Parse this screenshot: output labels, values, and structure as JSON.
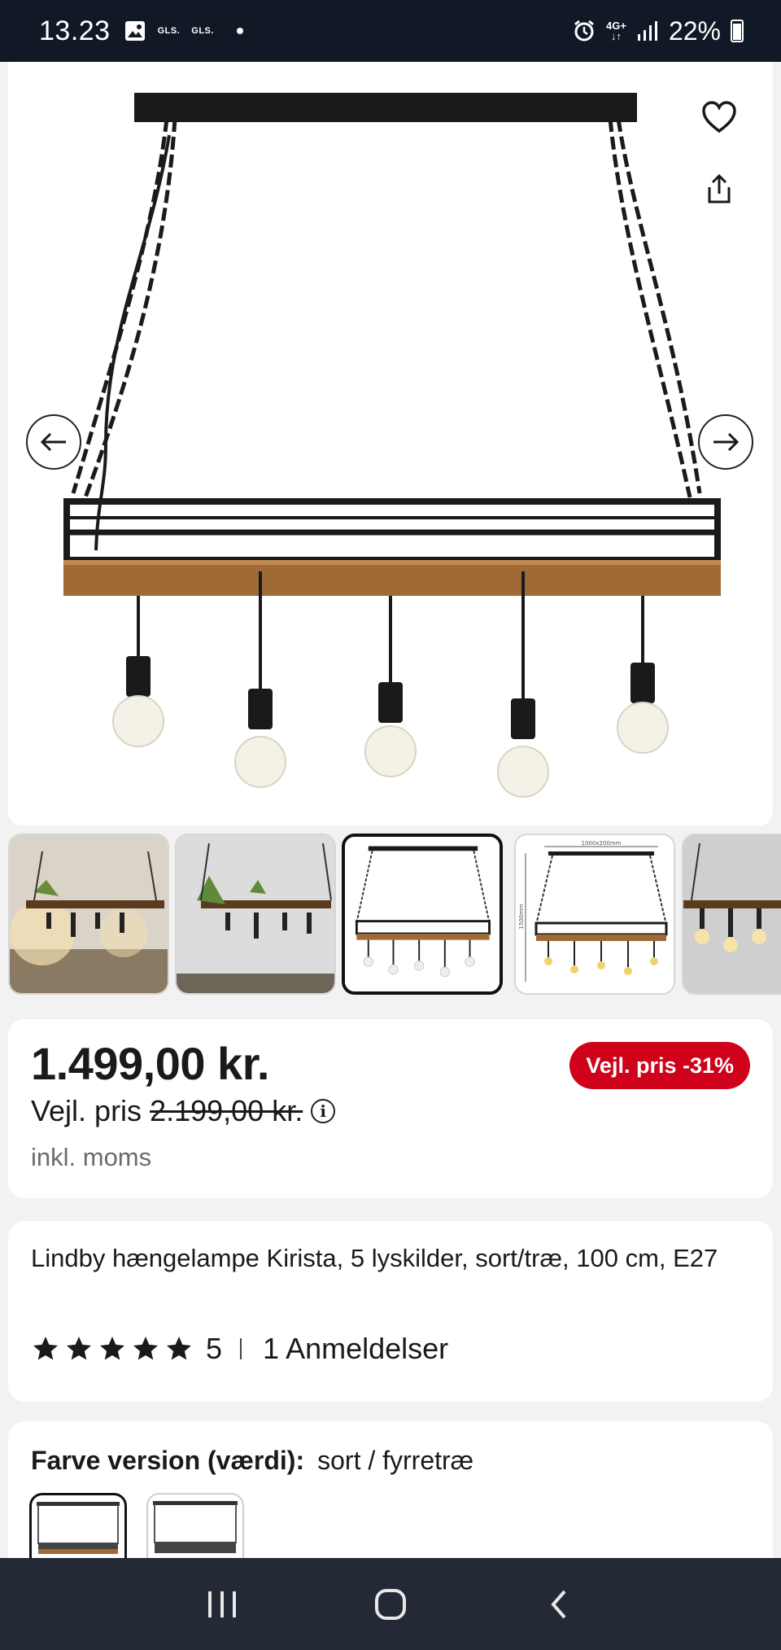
{
  "status_bar": {
    "time": "13.23",
    "notif1": "GLS.",
    "notif2": "GLS.",
    "network": "4G+",
    "battery": "22%"
  },
  "product": {
    "price": "1.499,00 kr.",
    "discount_badge": "Vejl. pris -31%",
    "rrp_label": "Vejl. pris",
    "rrp_price": "2.199,00 kr.",
    "vat_note": "inkl. moms",
    "title": "Lindby hængelampe Kirista, 5 lyskilder, sort/træ, 100 cm, E27",
    "rating_value": "5",
    "reviews": "1 Anmeldelser",
    "rating_stars": 5
  },
  "variant": {
    "label": "Farve version (værdi):",
    "value": "sort / fyrretræ"
  },
  "thumb_dims": {
    "width_label": "1000x200mm",
    "height_label": "1500mm"
  },
  "colors": {
    "badge": "#d0021b",
    "wood": "#a06a36",
    "metal": "#1a1a1a"
  },
  "icons": [
    "heart-icon",
    "share-icon",
    "arrow-left-icon",
    "arrow-right-icon",
    "star-icon",
    "info-icon",
    "recent-apps-icon",
    "home-icon",
    "back-icon"
  ]
}
